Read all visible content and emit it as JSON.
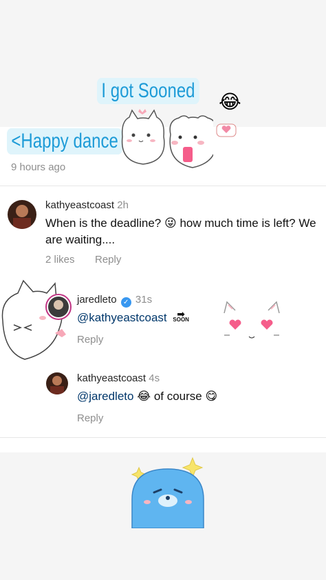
{
  "stickers": {
    "line1": "I got Sooned",
    "line1_emoji": "😂",
    "line2": "Happy dance",
    "line2_arrow": "<"
  },
  "post": {
    "time_ago": "9 hours ago"
  },
  "comments": [
    {
      "username": "kathyeastcoast",
      "time": "2h",
      "text": "When is the deadline?",
      "emoji": "😜",
      "text_cont": "how much time is left? We are waiting....",
      "likes": "2 likes",
      "reply": "Reply"
    },
    {
      "username": "jaredleto",
      "verified": true,
      "time": "31s",
      "mention": "@kathyeastcoast",
      "soon_label": "SOON",
      "reply": "Reply"
    },
    {
      "username": "kathyeastcoast",
      "time": "4s",
      "mention": "@jaredleto",
      "emoji": "😂",
      "text": "of course",
      "emoji2": "😋",
      "reply": "Reply"
    }
  ],
  "colors": {
    "mention": "#00376b",
    "verified": "#3897f0",
    "sticker_text": "#1d9bd7"
  }
}
